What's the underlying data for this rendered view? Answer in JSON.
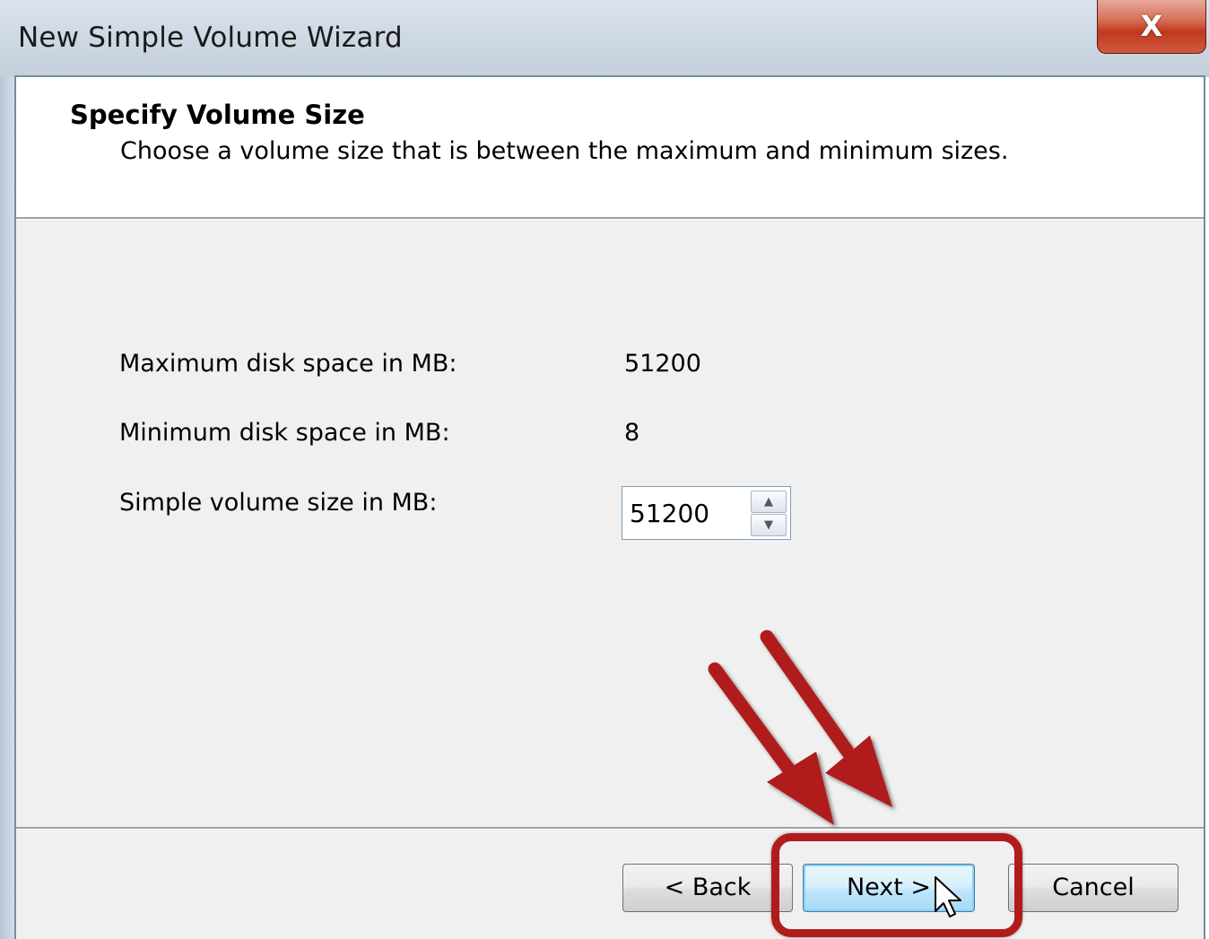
{
  "window": {
    "title": "New Simple Volume Wizard",
    "close_glyph": "X"
  },
  "header": {
    "title": "Specify Volume Size",
    "subtitle": "Choose a volume size that is between the maximum and minimum sizes."
  },
  "form": {
    "max_label": "Maximum disk space in MB:",
    "max_value": "51200",
    "min_label": "Minimum disk space in MB:",
    "min_value": "8",
    "size_label": "Simple volume size in MB:",
    "size_value": "51200",
    "spin_up_icon": "triangle-up-icon",
    "spin_down_icon": "triangle-down-icon"
  },
  "buttons": {
    "back": "< Back",
    "next": "Next >",
    "cancel": "Cancel"
  },
  "annotations": {
    "arrow_color": "#b01c1c",
    "highlight_color": "#b01c1c",
    "cursor_icon": "mouse-pointer-icon"
  }
}
